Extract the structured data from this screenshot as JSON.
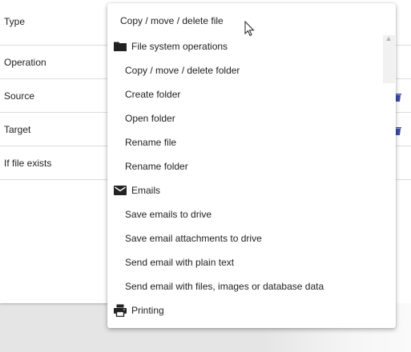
{
  "form": {
    "rows": [
      {
        "label": "Type"
      },
      {
        "label": "Operation"
      },
      {
        "label": "Source"
      },
      {
        "label": "Target"
      },
      {
        "label": "If file exists"
      }
    ]
  },
  "dropdown": {
    "selected": "Copy / move / delete file",
    "groups": [
      {
        "label": "File system operations",
        "icon": "folder-icon",
        "items": [
          "Copy / move / delete folder",
          "Create folder",
          "Open folder",
          "Rename file",
          "Rename folder"
        ]
      },
      {
        "label": "Emails",
        "icon": "mail-icon",
        "items": [
          "Save emails to drive",
          "Save email attachments to drive",
          "Send email with plain text",
          "Send email with files, images or database data"
        ]
      },
      {
        "label": "Printing",
        "icon": "printer-icon",
        "items": []
      }
    ]
  },
  "colors": {
    "side_icon": "#3a4aa8",
    "divider": "#dcdcdc"
  }
}
